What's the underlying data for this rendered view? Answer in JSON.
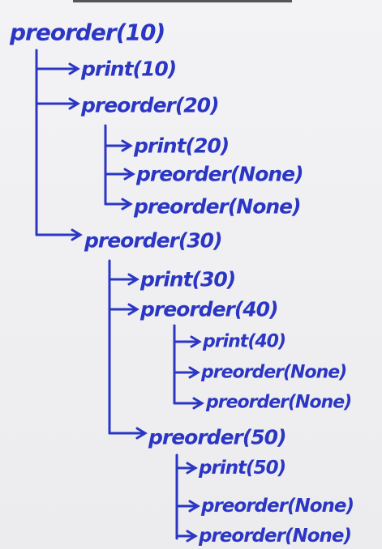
{
  "ink_color": "#2b36c4",
  "tree": {
    "root": "preorder(10)",
    "nodes": [
      "print(10)",
      "preorder(20)",
      "print(20)",
      "preorder(None)",
      "preorder(None)",
      "preorder(30)",
      "print(30)",
      "preorder(40)",
      "print(40)",
      "preorder(None)",
      "preorder(None)",
      "preorder(50)",
      "print(50)",
      "preorder(None)",
      "preorder(None)"
    ]
  }
}
